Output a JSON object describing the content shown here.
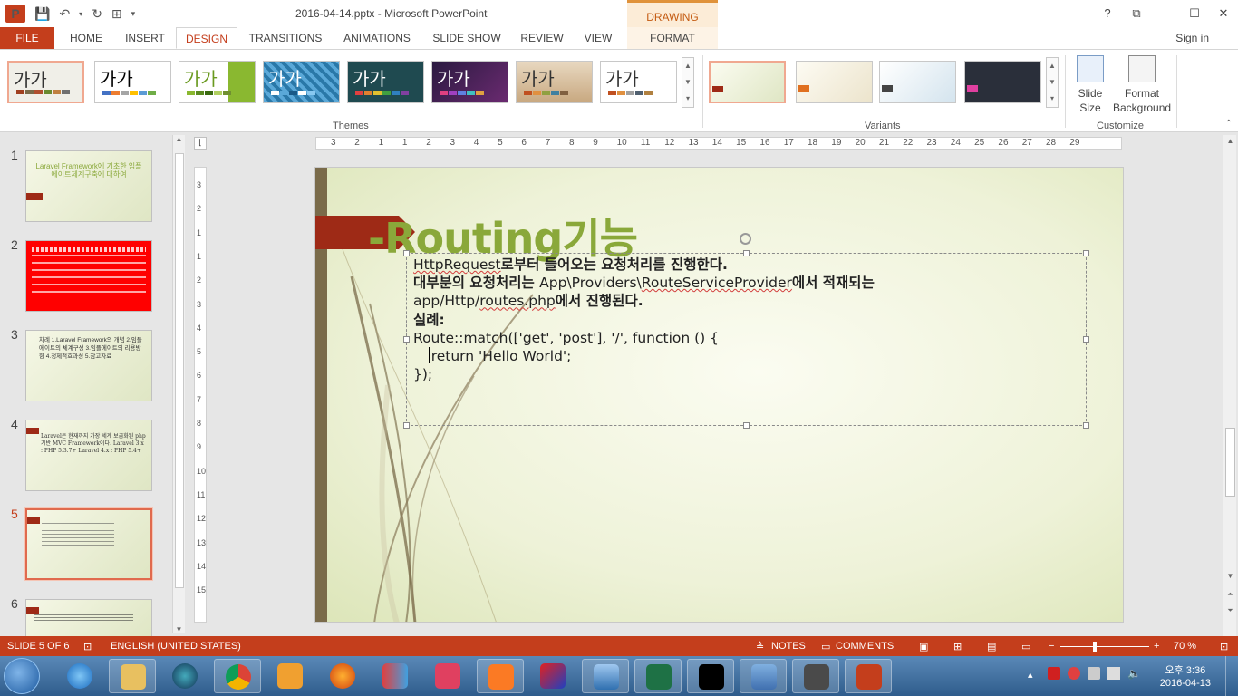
{
  "window": {
    "title": "2016-04-14.pptx - Microsoft PowerPoint",
    "contextual_group": "DRAWING TOOLS",
    "help": "?",
    "controls": {
      "ribbon_display": "⧉",
      "minimize": "—",
      "maximize": "☐",
      "close": "✕"
    }
  },
  "ribbon": {
    "tabs": [
      "FILE",
      "HOME",
      "INSERT",
      "DESIGN",
      "TRANSITIONS",
      "ANIMATIONS",
      "SLIDE SHOW",
      "REVIEW",
      "VIEW",
      "FORMAT"
    ],
    "active_tab": "DESIGN",
    "sign_in": "Sign in",
    "themes_label": "Themes",
    "variants_label": "Variants",
    "customize_label": "Customize",
    "theme_sample_text": "가가",
    "slide_size_label_1": "Slide",
    "slide_size_label_2": "Size",
    "format_bg_label_1": "Format",
    "format_bg_label_2": "Background"
  },
  "thumbnails": [
    {
      "number": "1",
      "text": "Laravel Framework에 기초한 임플에이트체계구축에 대하여"
    },
    {
      "number": "2",
      "text": ""
    },
    {
      "number": "3",
      "text": "차례  1.Laravel Framework의 개념 2.임플에이트의 체계구성 3.임플에이트의 리용방향 4.정제적효과성 5.참고자료"
    },
    {
      "number": "4",
      "text": "Laravel은 현재까지 가장 세계 보급화된 php기반 MVC Framework이다. Laravel 3.x : PHP 5.3.7+  Laravel 4.x : PHP 5.4+"
    },
    {
      "number": "5",
      "text": ""
    },
    {
      "number": "6",
      "text": ""
    }
  ],
  "rulers": {
    "horizontal": [
      "3",
      "2",
      "1",
      "1",
      "2",
      "3",
      "4",
      "5",
      "6",
      "7",
      "8",
      "9",
      "10",
      "11",
      "12",
      "13",
      "14",
      "15",
      "16",
      "17",
      "18",
      "19",
      "20",
      "21",
      "22",
      "23",
      "24",
      "25",
      "26",
      "27",
      "28",
      "29"
    ],
    "vertical": [
      "3",
      "2",
      "1",
      "1",
      "2",
      "3",
      "4",
      "5",
      "6",
      "7",
      "8",
      "9",
      "10",
      "11",
      "12",
      "13",
      "14",
      "15"
    ]
  },
  "slide": {
    "title": "-Routing기능",
    "line1_code": "HttpRequest",
    "line1_rest": "로부터 들어오는 요청처리를 진행한다.",
    "line2_a": "대부분의 요청처리는 ",
    "line2_b": "App\\Providers\\",
    "line2_c": "RouteServiceProvider",
    "line2_d": "에서 적재되는",
    "line3_a": "app/Http/",
    "line3_b": "routes.php",
    "line3_c": "에서 진행된다.",
    "line4": "실례:",
    "line5": "Route::match(['get', 'post'], '/', function () {",
    "line6": "    return 'Hello World';",
    "line7": "});"
  },
  "status": {
    "slide_indicator": "SLIDE 5 OF 6",
    "language": "ENGLISH (UNITED STATES)",
    "notes": "NOTES",
    "comments": "COMMENTS",
    "zoom": "70 %",
    "zoom_level": 0.38
  },
  "taskbar": {
    "time": "오후 3:36",
    "date": "2016-04-13"
  },
  "colors": {
    "accent": "#c43e1c",
    "title_green": "#8aa83a",
    "slide_red": "#9e2a16"
  }
}
